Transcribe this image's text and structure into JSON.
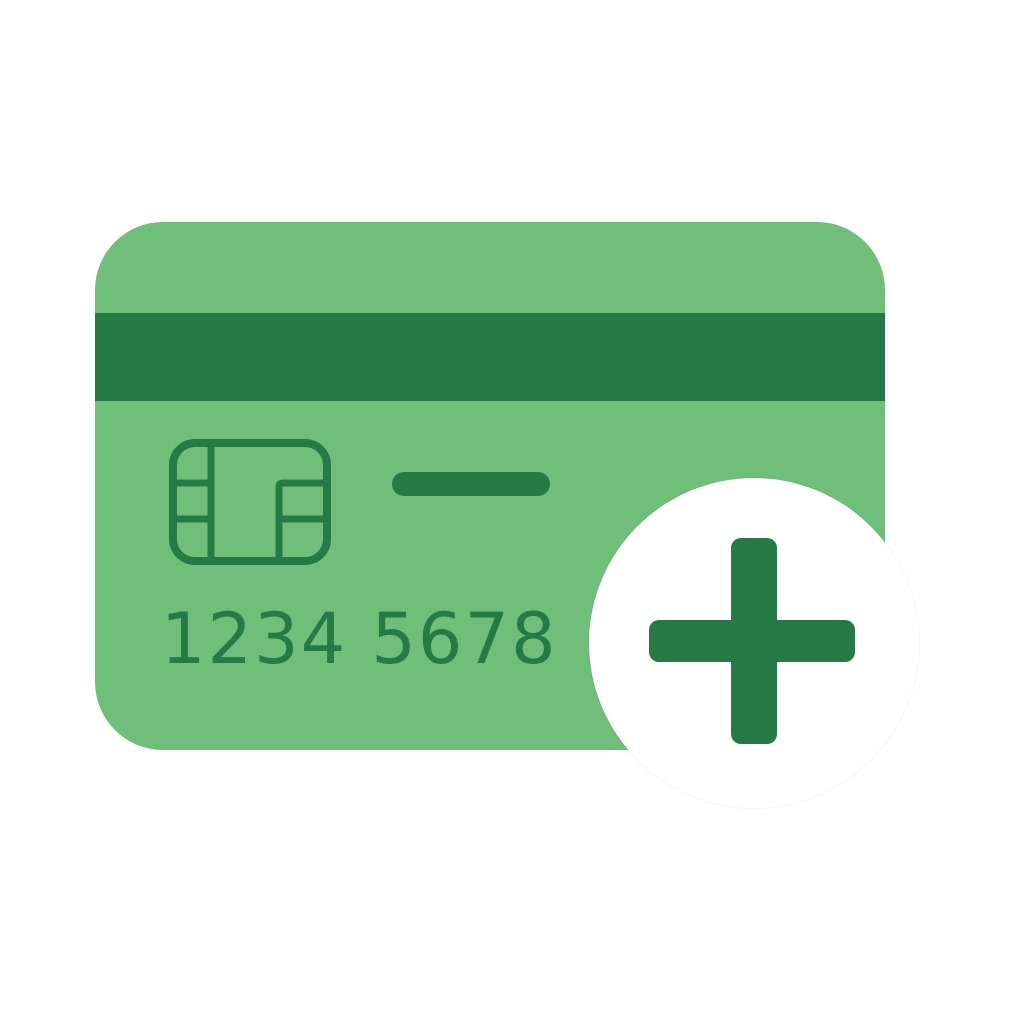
{
  "icon": {
    "card": {
      "number": "1234 5678",
      "colors": {
        "body": "#6fbe7a",
        "accent": "#267a45"
      },
      "chip_icon": "chip-icon",
      "name_icon": "name-line-placeholder"
    },
    "badge": {
      "icon": "plus-icon",
      "background": "#ffffff",
      "accent": "#267a45"
    }
  }
}
